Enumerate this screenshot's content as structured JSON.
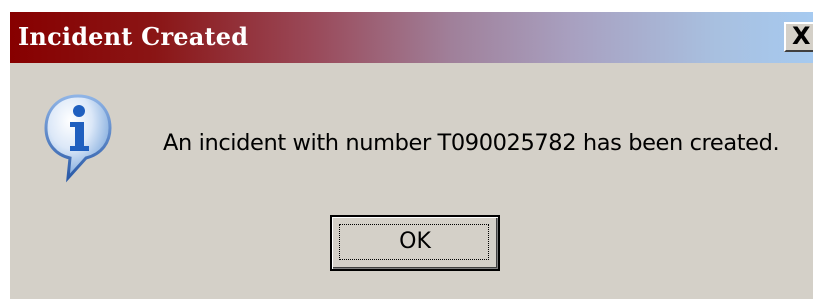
{
  "window": {
    "title": "Incident Created",
    "close_label": "X"
  },
  "content": {
    "icon": "information-icon",
    "message": "An incident with number T090025782 has been created."
  },
  "buttons": {
    "ok_label": "OK"
  },
  "colors": {
    "titlebar_start": "#870000",
    "titlebar_end": "#a6caf0",
    "dialog_bg": "#d4d0c8",
    "icon_blue": "#2f6fcf"
  }
}
